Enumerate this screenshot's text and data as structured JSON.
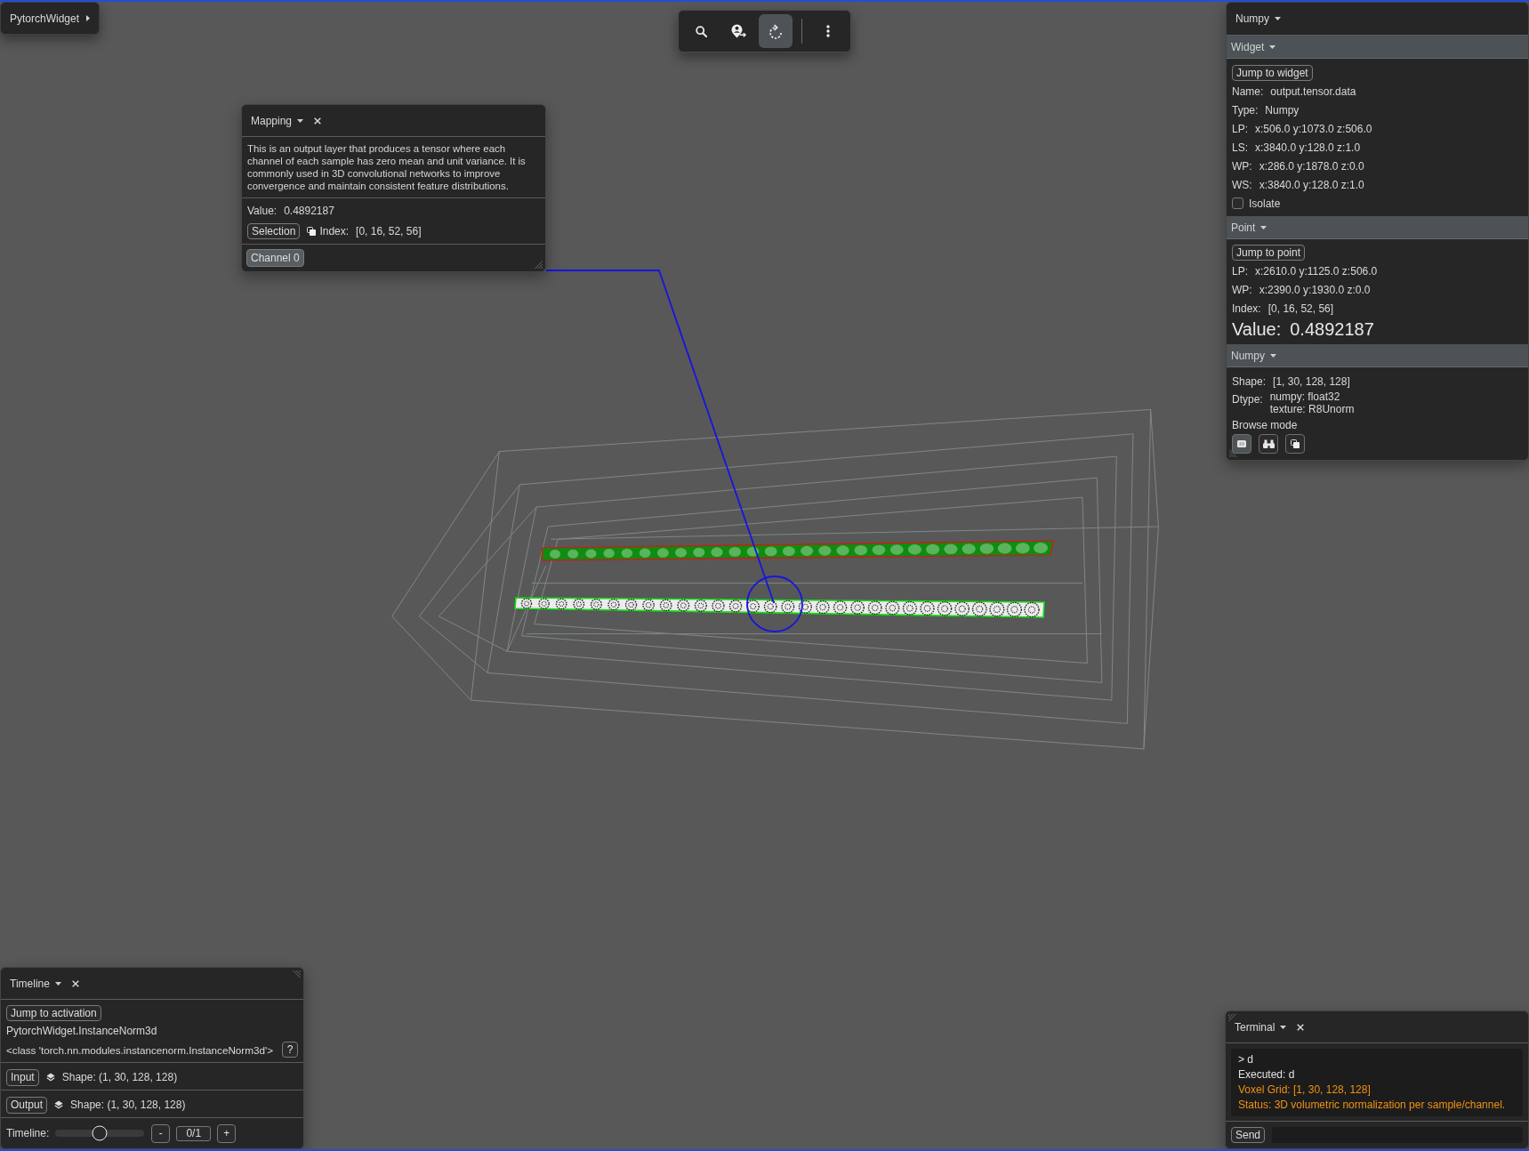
{
  "widget_menu": {
    "label": "PytorchWidget"
  },
  "toolbar": {
    "tools": [
      {
        "kind": "search",
        "selected": false
      },
      {
        "kind": "locate",
        "selected": false
      },
      {
        "kind": "rotate",
        "selected": true
      },
      {
        "kind": "more",
        "selected": false
      }
    ]
  },
  "mapping_panel": {
    "title": "Mapping",
    "description": "This is an output layer that produces a tensor where each channel of each sample has zero mean and unit variance. It is commonly used in 3D convolutional networks to improve convergence and maintain consistent feature distributions.",
    "value_label": "Value:",
    "value": "0.4892187",
    "selection_button": "Selection",
    "index_label": "Index:",
    "index": "[0, 16, 52, 56]",
    "channels": [
      {
        "label": "Channel 0",
        "selected": true
      }
    ]
  },
  "inspector": {
    "title": "Numpy",
    "widget": {
      "title": "Widget",
      "button": "Jump to widget",
      "fields": [
        {
          "label": "Name:",
          "value": "output.tensor.data"
        },
        {
          "label": "Type:",
          "value": "Numpy"
        },
        {
          "label": "LP:",
          "value": "x:506.0 y:1073.0 z:506.0"
        },
        {
          "label": "LS:",
          "value": "x:3840.0 y:128.0 z:1.0"
        },
        {
          "label": "WP:",
          "value": "x:286.0 y:1878.0 z:0.0"
        },
        {
          "label": "WS:",
          "value": "x:3840.0 y:128.0 z:1.0"
        }
      ],
      "isolate": {
        "label": "Isolate",
        "checked": false
      }
    },
    "point": {
      "title": "Point",
      "button": "Jump to point",
      "fields": [
        {
          "label": "LP:",
          "value": "x:2610.0 y:1125.0 z:506.0"
        },
        {
          "label": "WP:",
          "value": "x:2390.0 y:1930.0 z:0.0"
        },
        {
          "label": "Index:",
          "value": "[0, 16, 52, 56]"
        }
      ],
      "value_label": "Value:",
      "value": "0.4892187"
    },
    "numpy": {
      "title": "Numpy",
      "fields": [
        {
          "label": "Shape:",
          "value": "[1, 30, 128, 128]"
        },
        {
          "label": "Dtype:",
          "lines": [
            "numpy: float32",
            "texture: R8Unorm"
          ]
        }
      ],
      "browse_label": "Browse mode",
      "browse_modes": [
        {
          "kind": "tile",
          "selected": true
        },
        {
          "kind": "binoculars",
          "selected": false
        },
        {
          "kind": "stack",
          "selected": false
        }
      ]
    }
  },
  "timeline_panel": {
    "title": "Timeline",
    "jump_button": "Jump to activation",
    "module_name": "PytorchWidget.InstanceNorm3d",
    "class_name": "<class 'torch.nn.modules.instancenorm.InstanceNorm3d'>",
    "help_button": "?",
    "ports": [
      {
        "button": "Input",
        "shape": "Shape: (1, 30, 128, 128)"
      },
      {
        "button": "Output",
        "shape": "Shape: (1, 30, 128, 128)"
      }
    ],
    "scrubber": {
      "label": "Timeline:",
      "level": 0.5,
      "minus": "-",
      "frame": "0/1",
      "plus": "+"
    }
  },
  "terminal": {
    "title": "Terminal",
    "lines": [
      {
        "text": "> d",
        "color": "#e2e2e2"
      },
      {
        "text": "Executed: d",
        "color": "#e2e2e2"
      },
      {
        "text": "Voxel Grid: [1, 30, 128, 128]",
        "color": "#ee9214"
      },
      {
        "text": "Status: 3D volumetric normalization per sample/channel.",
        "color": "#ee9214"
      }
    ],
    "send_button": "Send"
  }
}
